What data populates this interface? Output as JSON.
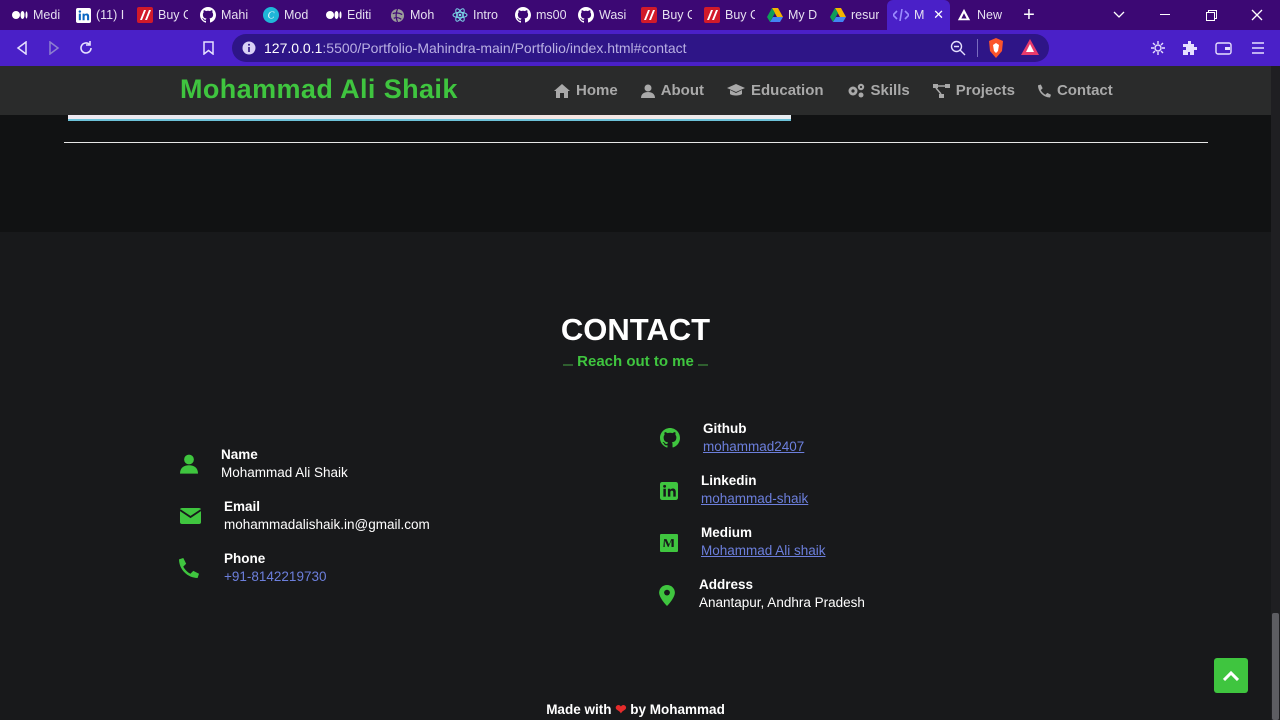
{
  "browser": {
    "tabs": [
      {
        "title": "Medi",
        "icon": "medium-icon"
      },
      {
        "title": "(11) I",
        "icon": "linkedin-icon"
      },
      {
        "title": "Buy C",
        "icon": "shop-icon"
      },
      {
        "title": "Mahi",
        "icon": "github-icon"
      },
      {
        "title": "Mod",
        "icon": "canva-icon"
      },
      {
        "title": "Editi",
        "icon": "medium-icon"
      },
      {
        "title": "Moh",
        "icon": "globe-icon"
      },
      {
        "title": "Intro",
        "icon": "react-icon"
      },
      {
        "title": "ms00",
        "icon": "github-icon"
      },
      {
        "title": "Wasi",
        "icon": "github-icon"
      },
      {
        "title": "Buy C",
        "icon": "shop-icon"
      },
      {
        "title": "Buy C",
        "icon": "shop-icon"
      },
      {
        "title": "My D",
        "icon": "drive-icon"
      },
      {
        "title": "resur",
        "icon": "drive-icon"
      },
      {
        "title": "M",
        "icon": "code-icon",
        "active": true
      },
      {
        "title": "New",
        "icon": "brave-icon"
      }
    ],
    "url_host": "127.0.0.1",
    "url_path": ":5500/Portfolio-Mahindra-main/Portfolio/index.html#contact"
  },
  "site": {
    "brand": "Mohammad Ali Shaik",
    "nav": [
      {
        "label": "Home",
        "icon": "home-icon"
      },
      {
        "label": "About",
        "icon": "user-icon"
      },
      {
        "label": "Education",
        "icon": "graduation-cap-icon"
      },
      {
        "label": "Skills",
        "icon": "gears-icon"
      },
      {
        "label": "Projects",
        "icon": "project-diagram-icon"
      },
      {
        "label": "Contact",
        "icon": "phone-icon"
      }
    ]
  },
  "contact": {
    "title": "CONTACT",
    "subtitle": "Reach out to me",
    "left": [
      {
        "label": "Name",
        "value": "Mohammad Ali Shaik",
        "icon": "user-icon"
      },
      {
        "label": "Email",
        "value": "mohammadalishaik.in@gmail.com",
        "icon": "envelope-icon"
      },
      {
        "label": "Phone",
        "value": "+91-8142219730",
        "icon": "phone-icon"
      }
    ],
    "right": [
      {
        "label": "Github",
        "value": "mohammad2407",
        "icon": "github-icon"
      },
      {
        "label": "Linkedin",
        "value": "mohammad-shaik",
        "icon": "linkedin-icon"
      },
      {
        "label": "Medium",
        "value": "Mohammad Ali shaik",
        "icon": "medium-icon"
      },
      {
        "label": "Address",
        "value": "Anantapur, Andhra Pradesh",
        "icon": "map-marker-icon"
      }
    ]
  },
  "footer": {
    "pre": "Made with",
    "post": "by Mohammad"
  },
  "colors": {
    "accent": "#3fc53f",
    "link": "#6c7fdc",
    "background": "#18191b"
  }
}
